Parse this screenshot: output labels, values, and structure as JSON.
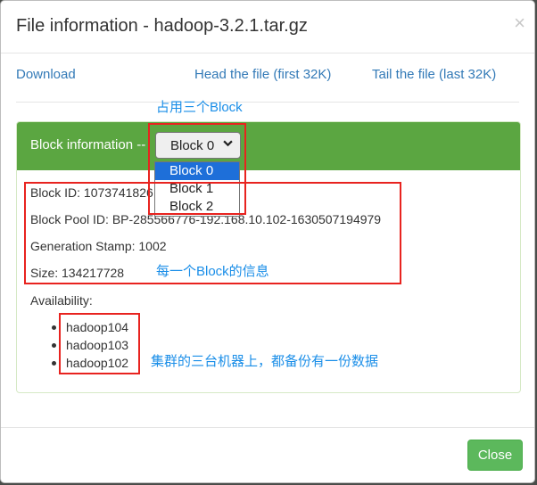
{
  "modal": {
    "title": "File information - hadoop-3.2.1.tar.gz",
    "close_glyph": "×"
  },
  "links": {
    "download": "Download",
    "head": "Head the file (first 32K)",
    "tail": "Tail the file (last 32K)"
  },
  "panel": {
    "heading_label": "Block information --",
    "select": {
      "selected": "Block 0",
      "chevron_icon": "chevron-down-icon",
      "options": [
        "Block 0",
        "Block 1",
        "Block 2"
      ]
    }
  },
  "info": {
    "block_id": "Block ID: 1073741826",
    "block_pool_id": "Block Pool ID: BP-285566776-192.168.10.102-1630507194979",
    "generation_stamp": "Generation Stamp: 1002",
    "size": "Size: 134217728",
    "availability_label": "Availability:",
    "availability": [
      "hadoop104",
      "hadoop103",
      "hadoop102"
    ]
  },
  "footer": {
    "close_label": "Close"
  },
  "annotations": {
    "uses_three_blocks": "占用三个Block",
    "block_info": "每一个Block的信息",
    "replicas": "集群的三台机器上，都备份有一份数据"
  },
  "colors": {
    "panel_heading": "#5ba641",
    "link": "#337ab7",
    "close_button": "#5cb85c",
    "annotation_box": "#e8231f",
    "annotation_text": "#1a8ee8",
    "selected_option": "#1e6fd9"
  }
}
